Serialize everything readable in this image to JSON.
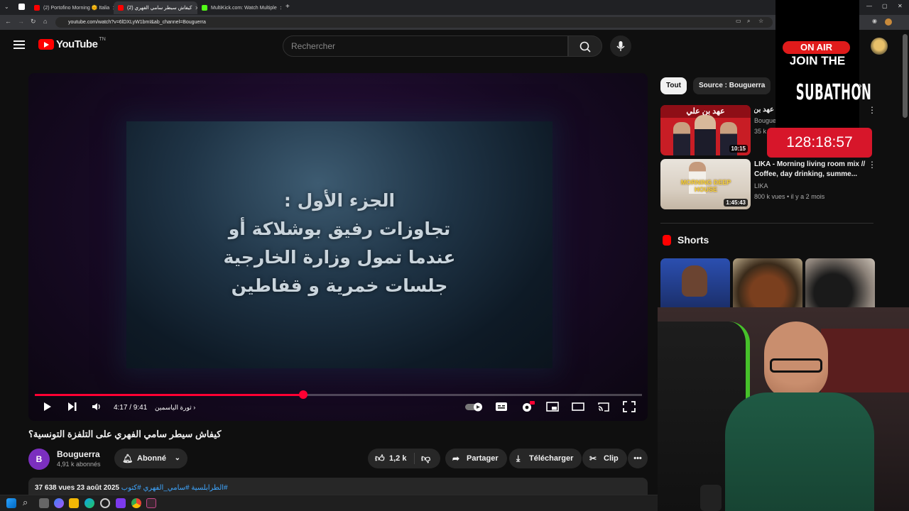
{
  "browser": {
    "tabs": [
      {
        "title": "(2) Portofino Morning 🌞 Italia",
        "active": false,
        "favicon_color": "#ff0000"
      },
      {
        "title": "كيفاش سيطر سامي الفهري (2)",
        "active": true,
        "favicon_color": "#ff0000"
      },
      {
        "title": "MultiKick.com: Watch Multiple",
        "active": false,
        "favicon_color": "#53fc18"
      }
    ],
    "url": "youtube.com/watch?v=6lDXLyW1bmI&ab_channel=Bouguerra"
  },
  "masthead": {
    "logo_text": "YouTube",
    "country_code": "TN",
    "search_placeholder": "Rechercher"
  },
  "player": {
    "screen_text_lines": [
      "الجزء الأول :",
      "تجاوزات رفيق بوشلاكة أو",
      "عندما تمول وزارة الخارجية",
      "جلسات خمرية و قفاطين"
    ],
    "time": "4:17 / 9:41",
    "chapter": "ثورة الياسمين",
    "progress_percent": 44.2
  },
  "video": {
    "title": "كيفاش سيطر سامي الفهري على التلفزة التونسية؟",
    "channel_name": "Bouguerra",
    "channel_subs": "4,91 k abonnés",
    "subscribe_label": "Abonné",
    "likes": "1,2 k",
    "share_label": "Partager",
    "download_label": "Télécharger",
    "clip_label": "Clip",
    "views": "37 638 vues",
    "date": "23 août 2025",
    "tags": "#الطرابلسية #سامي_الفهري #كتوب"
  },
  "sidebar": {
    "chips": [
      {
        "label": "Tout",
        "selected": true
      },
      {
        "label": "Source : Bouguerra",
        "selected": false
      }
    ],
    "recommendations": [
      {
        "title": "عهد بن علي؟",
        "channel": "Bougue",
        "meta": "35 k",
        "duration": "10:15",
        "thumb_caption": "عهد بن علي"
      },
      {
        "title": "LIKA - Morning living room mix // Coffee, day drinking, summe...",
        "channel": "LIKA",
        "meta": "800 k vues • il y a 2 mois",
        "duration": "1:45:43",
        "thumb_caption": "MORNING DEEP HOUSE"
      }
    ],
    "shorts_title": "Shorts"
  },
  "overlay": {
    "on_air": "ON AIR",
    "join": "JOIN THE",
    "subathon": "SUBATHON",
    "timer": "128:18:57"
  },
  "colors": {
    "accent": "#ff0033",
    "youtube_red": "#ff0000",
    "link_blue": "#3ea6ff",
    "timer_red": "#d7162a"
  }
}
